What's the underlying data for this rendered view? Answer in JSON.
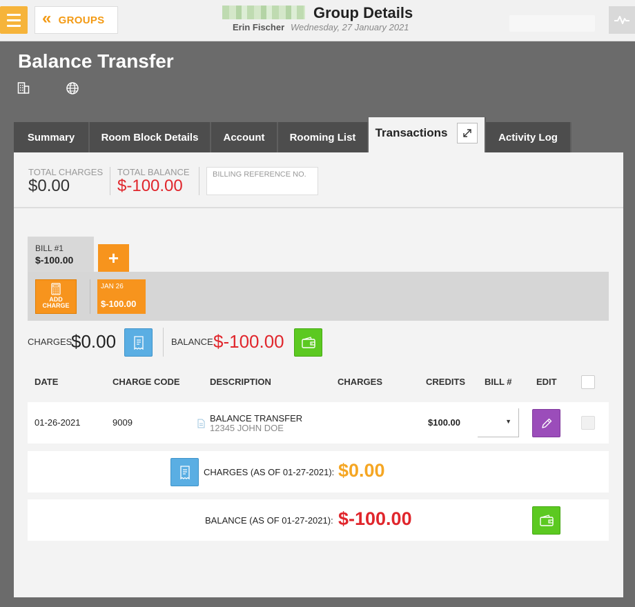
{
  "topbar": {
    "groups_label": "GROUPS",
    "page_title": "Group Details",
    "user_name": "Erin Fischer",
    "date": "Wednesday, 27 January 2021"
  },
  "header": {
    "title": "Balance Transfer"
  },
  "tabs": [
    {
      "label": "Summary"
    },
    {
      "label": "Room Block Details"
    },
    {
      "label": "Account"
    },
    {
      "label": "Rooming List"
    },
    {
      "label": "Transactions"
    },
    {
      "label": "Activity Log"
    }
  ],
  "summary": {
    "total_charges_label": "TOTAL CHARGES",
    "total_charges_value": "$0.00",
    "total_balance_label": "TOTAL BALANCE",
    "total_balance_value": "$-100.00",
    "billing_ref_placeholder": "BILLING REFERENCE NO."
  },
  "bill": {
    "name": "BILL #1",
    "amount": "$-100.00",
    "add_bill_label": "+",
    "add_charge_label": "ADD CHARGE",
    "date_card_date": "JAN 26",
    "date_card_amount": "$-100.00"
  },
  "totals": {
    "charges_label": "CHARGES",
    "charges_value": "$0.00",
    "balance_label": "BALANCE",
    "balance_value": "$-100.00"
  },
  "table": {
    "headers": [
      "DATE",
      "CHARGE CODE",
      "DESCRIPTION",
      "CHARGES",
      "CREDITS",
      "BILL #",
      "EDIT"
    ],
    "rows": [
      {
        "date": "01-26-2021",
        "charge_code": "9009",
        "description": "BALANCE TRANSFER",
        "sub_description": "12345 JOHN DOE",
        "charges": "",
        "credits": "$100.00"
      }
    ]
  },
  "footer": {
    "charges_label": "CHARGES (AS OF 01-27-2021):",
    "charges_value": "$0.00",
    "balance_label": "BALANCE (AS OF 01-27-2021):",
    "balance_value": "$-100.00"
  },
  "colors": {
    "accent_orange": "#f7941d",
    "negative_red": "#e0262c",
    "charges_orange": "#f5a623",
    "receipt_blue": "#5aaee3",
    "wallet_green": "#5cc921",
    "edit_purple": "#9b4dba"
  }
}
